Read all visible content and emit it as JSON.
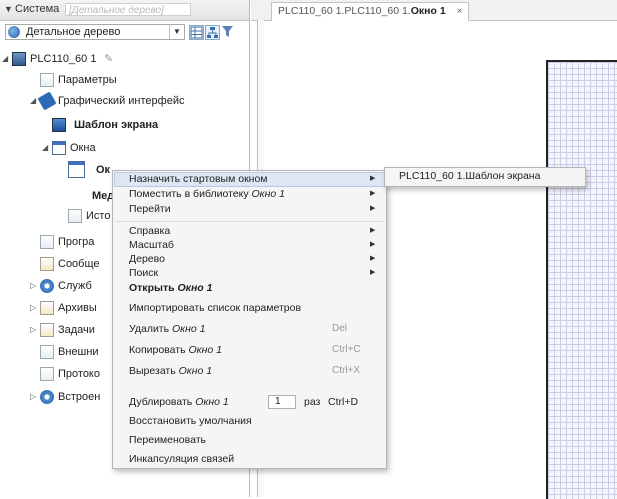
{
  "panel": {
    "title": "Система",
    "placeholder": "[Детальное дерево]"
  },
  "view_select": {
    "value": "Детальное дерево"
  },
  "tree": {
    "root": "PLC110_60 1",
    "params": "Параметры",
    "gui": "Графический интерфейс",
    "screen_template": "Шаблон экрана",
    "windows": "Окна",
    "window1": "Ок",
    "media": "Меди",
    "history": "Исто",
    "programs": "Програ",
    "messages": "Сообще",
    "services": "Служб",
    "archives": "Архивы",
    "tasks": "Задачи",
    "external": "Внешни",
    "protocols": "Протоко",
    "builtin": "Встроен"
  },
  "tab": {
    "prefix": "PLC110_60 1.PLC110_60 1.",
    "name": "Окно 1",
    "close": "×"
  },
  "menu": {
    "set_start": "Назначить стартовым окном",
    "place_lib": "Поместить в библиотеку",
    "place_lib_obj": "Окно 1",
    "goto": "Перейти",
    "help": "Справка",
    "scale": "Масштаб",
    "tree": "Дерево",
    "search": "Поиск",
    "open": "Открыть",
    "open_obj": "Окно 1",
    "import": "Импортировать список параметров",
    "delete": "Удалить",
    "delete_obj": "Окно 1",
    "delete_key": "Del",
    "copy": "Копировать",
    "copy_obj": "Окно 1",
    "copy_key": "Ctrl+C",
    "cut": "Вырезать",
    "cut_obj": "Окно 1",
    "cut_key": "Ctrl+X",
    "duplicate": "Дублировать",
    "duplicate_obj": "Окно 1",
    "dup_count": "1",
    "dup_times": "раз",
    "dup_key": "Ctrl+D",
    "restore": "Восстановить умолчания",
    "rename": "Переименовать",
    "encapsulate": "Инкапсуляция связей"
  },
  "submenu": {
    "item": "PLC110_60 1.Шаблон экрана"
  }
}
